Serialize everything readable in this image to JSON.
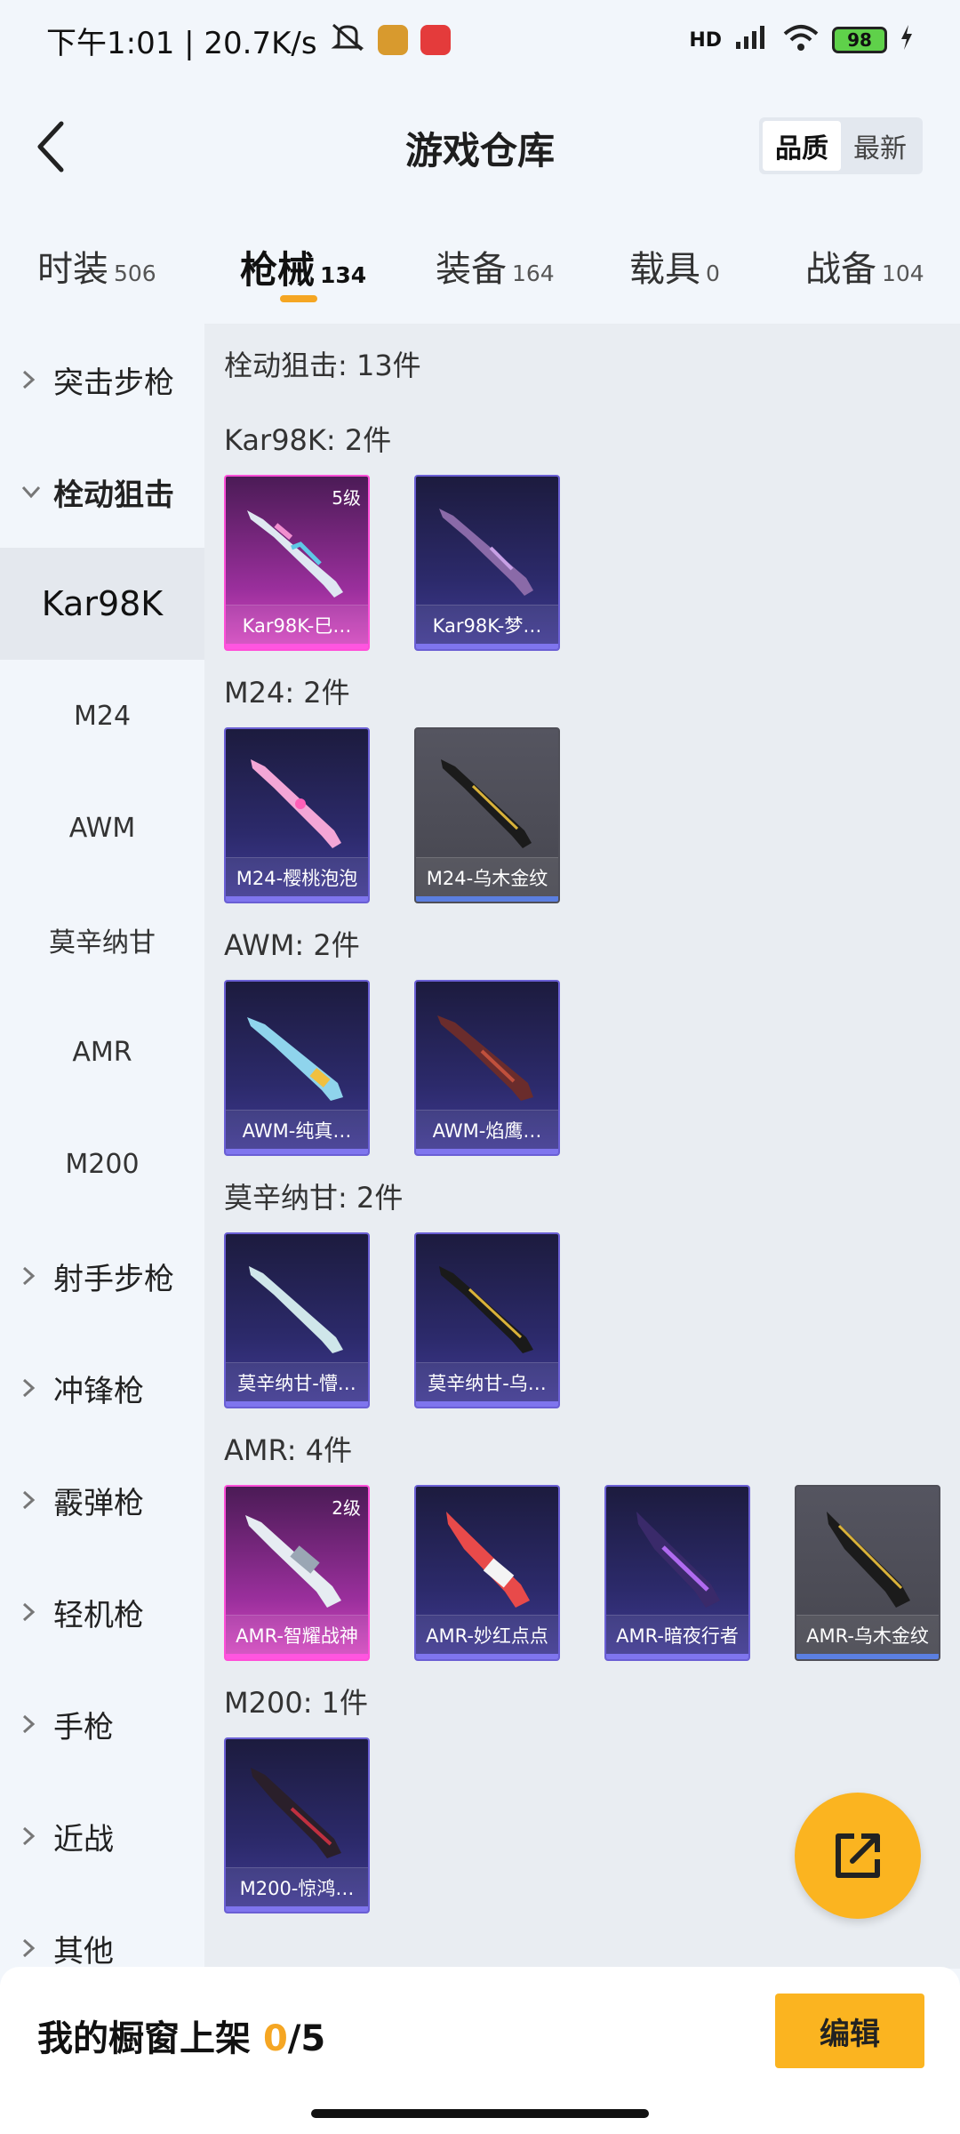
{
  "status_bar": {
    "time_speed": "下午1:01 | 20.7K/s",
    "network": "HD",
    "battery": "98"
  },
  "header": {
    "title": "游戏仓库",
    "sort": {
      "quality": "品质",
      "newest": "最新"
    }
  },
  "tabs": [
    {
      "label": "时装",
      "count": "506"
    },
    {
      "label": "枪械",
      "count": "134"
    },
    {
      "label": "装备",
      "count": "164"
    },
    {
      "label": "载具",
      "count": "0"
    },
    {
      "label": "战备",
      "count": "104"
    }
  ],
  "sidebar": {
    "items": [
      "突击步枪",
      "栓动狙击",
      "Kar98K",
      "M24",
      "AWM",
      "莫辛纳甘",
      "AMR",
      "M200",
      "射手步枪",
      "冲锋枪",
      "霰弹枪",
      "轻机枪",
      "手枪",
      "近战",
      "其他"
    ]
  },
  "content": {
    "category_heading": "栓动狙击: 13件",
    "groups": [
      {
        "heading": "Kar98K: 2件",
        "items": [
          {
            "name": "Kar98K-巳…",
            "level": "5级"
          },
          {
            "name": "Kar98K-梦…",
            "level": ""
          }
        ]
      },
      {
        "heading": "M24: 2件",
        "items": [
          {
            "name": "M24-樱桃泡泡",
            "level": ""
          },
          {
            "name": "M24-乌木金纹",
            "level": ""
          }
        ]
      },
      {
        "heading": "AWM: 2件",
        "items": [
          {
            "name": "AWM-纯真…",
            "level": ""
          },
          {
            "name": "AWM-焰鹰…",
            "level": ""
          }
        ]
      },
      {
        "heading": "莫辛纳甘: 2件",
        "items": [
          {
            "name": "莫辛纳甘-懵…",
            "level": ""
          },
          {
            "name": "莫辛纳甘-乌…",
            "level": ""
          }
        ]
      },
      {
        "heading": "AMR: 4件",
        "items": [
          {
            "name": "AMR-智耀战神",
            "level": "2级"
          },
          {
            "name": "AMR-妙红点点",
            "level": ""
          },
          {
            "name": "AMR-暗夜行者",
            "level": ""
          },
          {
            "name": "AMR-乌木金纹",
            "level": ""
          }
        ]
      },
      {
        "heading": "M200: 1件",
        "items": [
          {
            "name": "M200-惊鸿…",
            "level": ""
          }
        ]
      }
    ]
  },
  "bottom_bar": {
    "label": "我的橱窗上架",
    "current": "0",
    "total": "/5",
    "edit_label": "编辑"
  },
  "colors": {
    "accent": "#fbb420",
    "tab_indicator": "#f5a623"
  }
}
